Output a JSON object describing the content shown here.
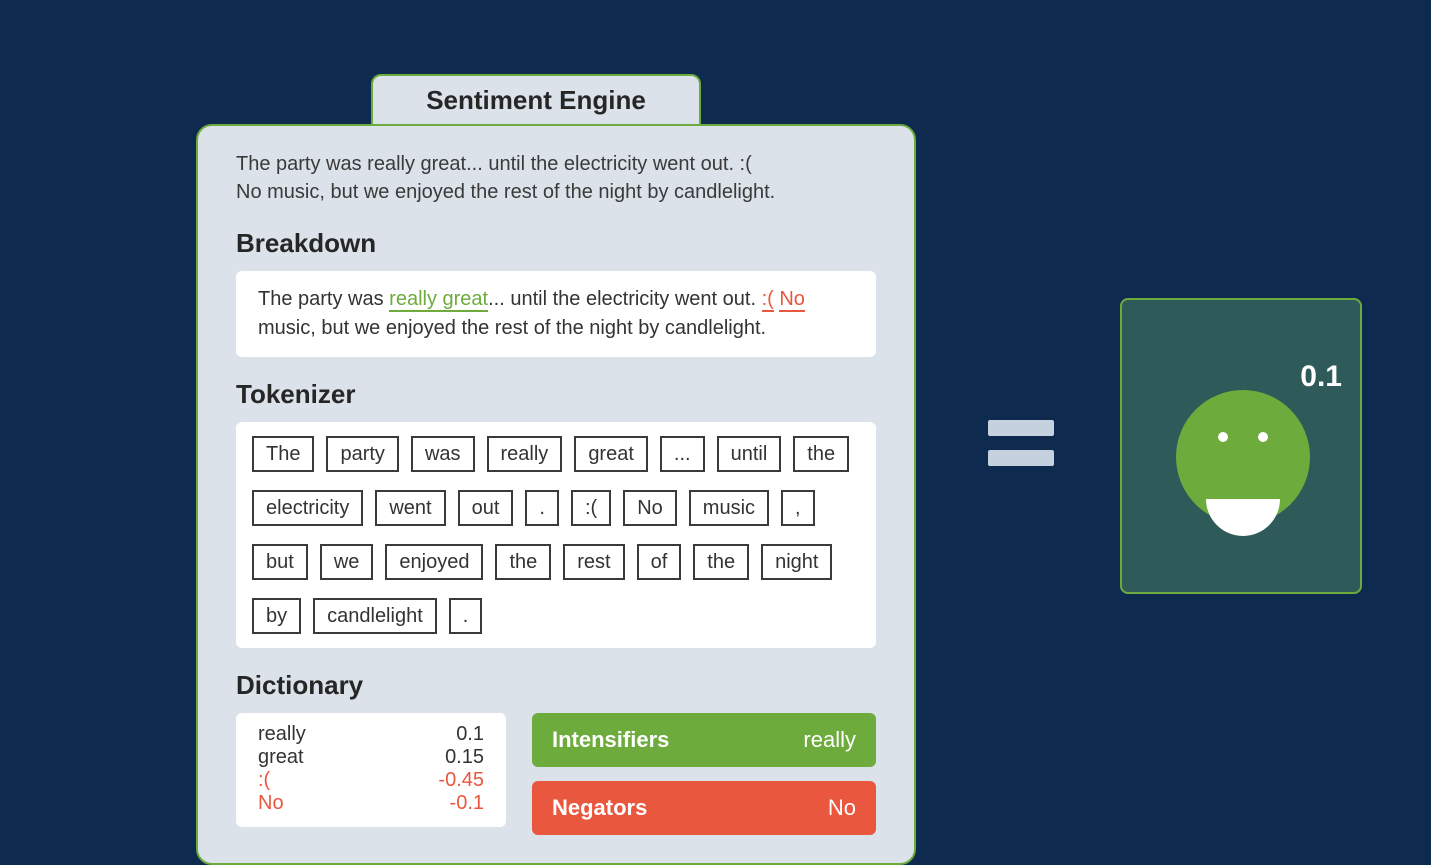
{
  "title": "Sentiment Engine",
  "input": {
    "line1": "The party was really great... until the electricity went out. :(",
    "line2": "No music, but we enjoyed the rest of the night by candlelight."
  },
  "sections": {
    "breakdown_heading": "Breakdown",
    "tokenizer_heading": "Tokenizer",
    "dictionary_heading": "Dictionary"
  },
  "breakdown": {
    "pre": "The party was ",
    "hl_green": "really great",
    "mid1": "... until the electricity went out. ",
    "hl_red1": ":(",
    "space": " ",
    "hl_red2": "No",
    "post": " music, but we enjoyed the rest of the night by candlelight."
  },
  "tokens": [
    "The",
    "party",
    "was",
    "really",
    "great",
    "...",
    "until",
    "the",
    "electricity",
    "went",
    "out",
    ".",
    ":(",
    "No",
    "music",
    ",",
    "but",
    "we",
    "enjoyed",
    "the",
    "rest",
    "of",
    "the",
    "night",
    "by",
    "candlelight",
    "."
  ],
  "dictionary": [
    {
      "word": "really",
      "score": "0.1",
      "neg": false
    },
    {
      "word": "great",
      "score": "0.15",
      "neg": false
    },
    {
      "word": ":(",
      "score": "-0.45",
      "neg": true
    },
    {
      "word": "No",
      "score": "-0.1",
      "neg": true
    }
  ],
  "intensifiers": {
    "label": "Intensifiers",
    "value": "really"
  },
  "negators": {
    "label": "Negators",
    "value": "No"
  },
  "result": {
    "score": "0.1",
    "sentiment": "positive"
  },
  "colors": {
    "green": "#6dab3c",
    "red": "#e9573f",
    "bg": "#0f2a4f",
    "panel": "#dbe2e9"
  }
}
